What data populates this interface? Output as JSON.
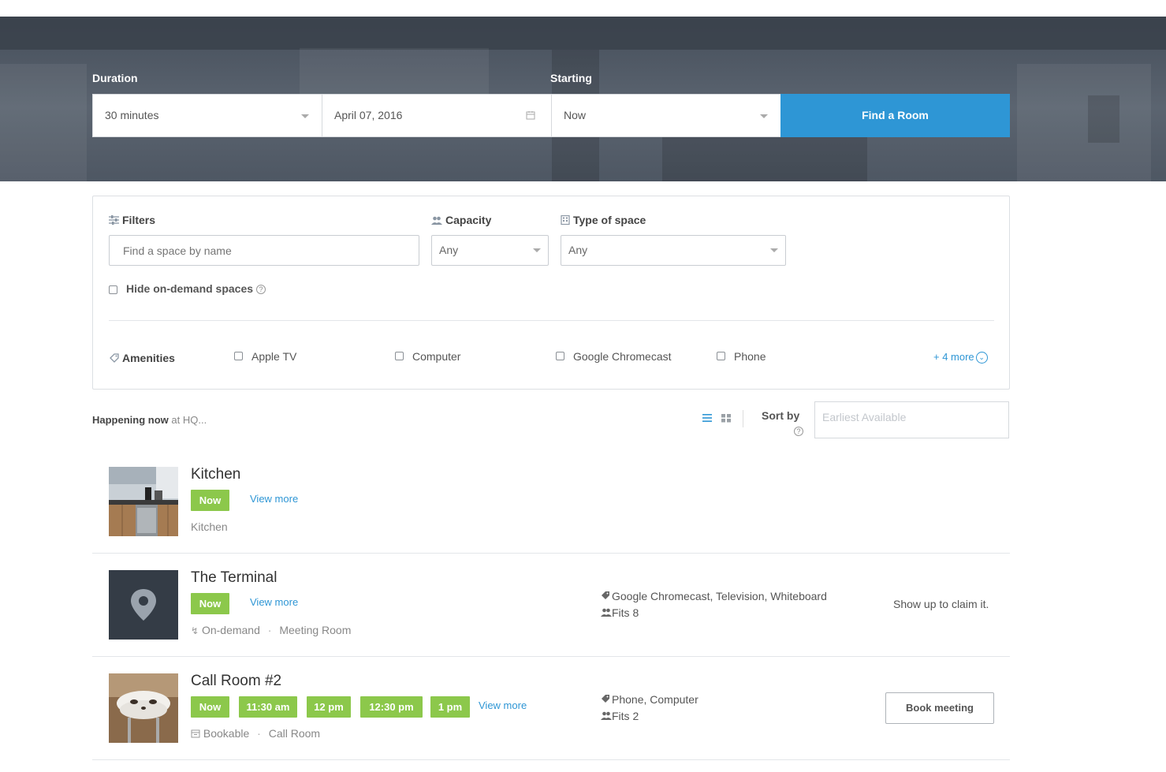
{
  "search": {
    "duration_label": "Duration",
    "starting_label": "Starting",
    "duration_value": "30 minutes",
    "date_value": "April 07, 2016",
    "time_value": "Now",
    "find_button": "Find a Room"
  },
  "filters": {
    "filters_label": "Filters",
    "name_placeholder": "Find a space by name",
    "capacity_label": "Capacity",
    "capacity_value": "Any",
    "type_label": "Type of space",
    "type_value": "Any",
    "hide_ondemand_label": "Hide on-demand spaces",
    "amenities_label": "Amenities",
    "amenities": [
      "Apple TV",
      "Computer",
      "Google Chromecast",
      "Phone"
    ],
    "more_label": "+ 4 more"
  },
  "list_header": {
    "happening": "Happening now",
    "location": "at HQ...",
    "sort_label": "Sort by",
    "sort_placeholder": "Earliest Available"
  },
  "rooms": [
    {
      "name": "Kitchen",
      "slots": [
        "Now"
      ],
      "view_more": "View more",
      "type": "Kitchen"
    },
    {
      "name": "The Terminal",
      "slots": [
        "Now"
      ],
      "view_more": "View more",
      "booking_mode": "On-demand",
      "type": "Meeting Room",
      "amenities": "Google Chromecast, Television, Whiteboard",
      "capacity": "Fits 8",
      "action": "Show up to claim it."
    },
    {
      "name": "Call Room #2",
      "slots": [
        "Now",
        "11:30 am",
        "12 pm",
        "12:30 pm",
        "1 pm"
      ],
      "view_more": "View more",
      "booking_mode": "Bookable",
      "type": "Call Room",
      "amenities": "Phone, Computer",
      "capacity": "Fits 2",
      "action": "Book meeting"
    }
  ],
  "colors": {
    "accent": "#2e96d5",
    "available": "#8cc84b"
  }
}
